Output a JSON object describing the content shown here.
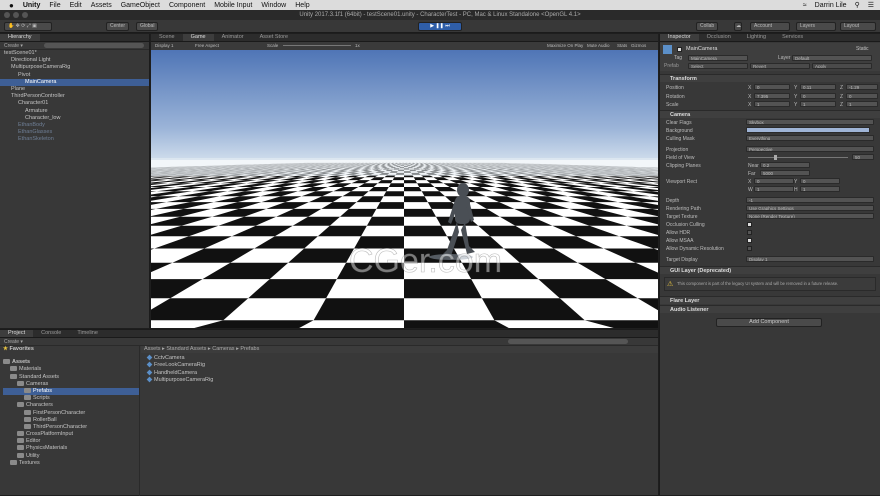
{
  "menubar": {
    "app": "Unity",
    "items": [
      "File",
      "Edit",
      "Assets",
      "GameObject",
      "Component",
      "Mobile Input",
      "Window",
      "Help"
    ],
    "user": "Darrin Lile"
  },
  "window": {
    "title": "Unity 2017.3.1f1 (64bit) - testScene01.unity - CharacterTest - PC, Mac & Linux Standalone <OpenGL 4.1>"
  },
  "toolbar": {
    "pivot": "Center",
    "global": "Global",
    "collab": "Collab",
    "account": "Account",
    "layers": "Layers",
    "layout": "Layout"
  },
  "hierarchy": {
    "tab": "Hierarchy",
    "create": "Create",
    "items": [
      {
        "label": "testScene01*",
        "indent": 0,
        "state": "normal"
      },
      {
        "label": "Directional Light",
        "indent": 1,
        "state": "normal"
      },
      {
        "label": "MultipurposeCameraRig",
        "indent": 1,
        "state": "normal"
      },
      {
        "label": "Pivot",
        "indent": 2,
        "state": "normal"
      },
      {
        "label": "MainCamera",
        "indent": 3,
        "state": "selected"
      },
      {
        "label": "Plane",
        "indent": 1,
        "state": "normal"
      },
      {
        "label": "ThirdPersonController",
        "indent": 1,
        "state": "normal"
      },
      {
        "label": "Character01",
        "indent": 2,
        "state": "normal"
      },
      {
        "label": "Armature",
        "indent": 3,
        "state": "normal"
      },
      {
        "label": "Character_low",
        "indent": 3,
        "state": "normal"
      },
      {
        "label": "EthanBody",
        "indent": 2,
        "state": "dim"
      },
      {
        "label": "EthanGlasses",
        "indent": 2,
        "state": "dim"
      },
      {
        "label": "EthanSkeleton",
        "indent": 2,
        "state": "dim"
      }
    ]
  },
  "viewtabs": {
    "scene": "Scene",
    "game": "Game",
    "animator": "Animator",
    "asset_store": "Asset Store"
  },
  "gamebar": {
    "display": "Display 1",
    "aspect": "Free Aspect",
    "scale_label": "Scale",
    "scale": "1x",
    "maximize": "Maximize On Play",
    "mute": "Mute Audio",
    "stats": "Stats",
    "gizmos": "Gizmos"
  },
  "watermark": "CGer.com",
  "inspector": {
    "tabs": [
      "Inspector",
      "Occlusion",
      "Lighting",
      "Services"
    ],
    "object_name": "MainCamera",
    "static": "Static",
    "tag_label": "Tag",
    "tag": "MainCamera",
    "layer_label": "Layer",
    "layer": "Default",
    "prefab": {
      "label": "Prefab",
      "select": "Select",
      "revert": "Revert",
      "apply": "Apply"
    },
    "transform": {
      "title": "Transform",
      "position": {
        "label": "Position",
        "x": "0",
        "y": "0.11",
        "z": "-1.29"
      },
      "rotation": {
        "label": "Rotation",
        "x": "7.395",
        "y": "0",
        "z": "0"
      },
      "scale": {
        "label": "Scale",
        "x": "1",
        "y": "1",
        "z": "1"
      }
    },
    "camera": {
      "title": "Camera",
      "clear_flags": {
        "label": "Clear Flags",
        "value": "Skybox"
      },
      "background": {
        "label": "Background",
        "color": "#9fb4d6"
      },
      "culling_mask": {
        "label": "Culling Mask",
        "value": "Everything"
      },
      "projection": {
        "label": "Projection",
        "value": "Perspective"
      },
      "fov": {
        "label": "Field of View",
        "value": "50"
      },
      "clipping": {
        "label": "Clipping Planes",
        "near_label": "Near",
        "near": "0.2",
        "far_label": "Far",
        "far": "5000"
      },
      "viewport": {
        "label": "Viewport Rect",
        "x": "0",
        "y": "0",
        "w": "1",
        "h": "1"
      },
      "depth": {
        "label": "Depth",
        "value": "-1"
      },
      "rendering_path": {
        "label": "Rendering Path",
        "value": "Use Graphics Settings"
      },
      "target_texture": {
        "label": "Target Texture",
        "value": "None (Render Texture)"
      },
      "occlusion": "Occlusion Culling",
      "hdr": "Allow HDR",
      "msaa": "Allow MSAA",
      "dynres": "Allow Dynamic Resolution",
      "target_display": {
        "label": "Target Display",
        "value": "Display 1"
      }
    },
    "gui_layer": {
      "title": "GUI Layer (Deprecated)",
      "warning": "This component is part of the legacy UI system and will be removed in a future release."
    },
    "flare_layer": "Flare Layer",
    "audio_listener": "Audio Listener",
    "add_component": "Add Component"
  },
  "project": {
    "tabs": [
      "Project",
      "Console",
      "Timeline"
    ],
    "create": "Create",
    "favorites": "Favorites",
    "tree": [
      {
        "label": "Assets",
        "indent": 0,
        "state": "bold"
      },
      {
        "label": "Materials",
        "indent": 1,
        "state": "normal"
      },
      {
        "label": "Standard Assets",
        "indent": 1,
        "state": "normal"
      },
      {
        "label": "Cameras",
        "indent": 2,
        "state": "normal"
      },
      {
        "label": "Prefabs",
        "indent": 3,
        "state": "selected"
      },
      {
        "label": "Scripts",
        "indent": 3,
        "state": "normal"
      },
      {
        "label": "Characters",
        "indent": 2,
        "state": "normal"
      },
      {
        "label": "FirstPersonCharacter",
        "indent": 3,
        "state": "normal"
      },
      {
        "label": "RollerBall",
        "indent": 3,
        "state": "normal"
      },
      {
        "label": "ThirdPersonCharacter",
        "indent": 3,
        "state": "normal"
      },
      {
        "label": "CrossPlatformInput",
        "indent": 2,
        "state": "normal"
      },
      {
        "label": "Editor",
        "indent": 2,
        "state": "normal"
      },
      {
        "label": "PhysicsMaterials",
        "indent": 2,
        "state": "normal"
      },
      {
        "label": "Utility",
        "indent": 2,
        "state": "normal"
      },
      {
        "label": "Textures",
        "indent": 1,
        "state": "normal"
      }
    ],
    "breadcrumb": [
      "Assets",
      "Standard Assets",
      "Cameras",
      "Prefabs"
    ],
    "files": [
      "CctvCamera",
      "FreeLookCameraRig",
      "HandheldCamera",
      "MultipurposeCameraRig"
    ]
  }
}
